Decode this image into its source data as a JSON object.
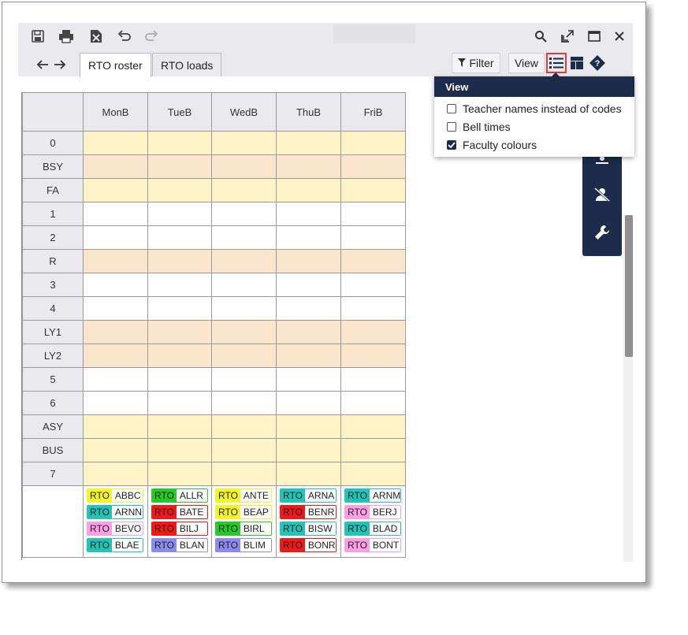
{
  "toolbar": {
    "tabs": [
      {
        "label": "RTO roster",
        "active": true
      },
      {
        "label": "RTO loads",
        "active": false
      }
    ],
    "filter_label": "Filter",
    "view_label": "View"
  },
  "grid": {
    "columns": [
      "MonB",
      "TueB",
      "WedB",
      "ThuB",
      "FriB"
    ],
    "rows": [
      {
        "label": "0",
        "color": "#fff4c8"
      },
      {
        "label": "BSY",
        "color": "#fae6cc"
      },
      {
        "label": "FA",
        "color": "#fff4c8"
      },
      {
        "label": "1",
        "color": "#ffffff"
      },
      {
        "label": "2",
        "color": "#ffffff"
      },
      {
        "label": "R",
        "color": "#fae6cc"
      },
      {
        "label": "3",
        "color": "#ffffff"
      },
      {
        "label": "4",
        "color": "#ffffff"
      },
      {
        "label": "LY1",
        "color": "#fae6cc"
      },
      {
        "label": "LY2",
        "color": "#fae6cc"
      },
      {
        "label": "5",
        "color": "#ffffff"
      },
      {
        "label": "6",
        "color": "#ffffff"
      },
      {
        "label": "ASY",
        "color": "#fff4c8"
      },
      {
        "label": "BUS",
        "color": "#fff4c8"
      },
      {
        "label": "7",
        "color": "#fff4c8"
      }
    ],
    "chip_code": "RTO",
    "chips": [
      [
        {
          "name": "ABBC",
          "color": "#f4f42a"
        },
        {
          "name": "ARNN",
          "color": "#22c4b8"
        },
        {
          "name": "BEVO",
          "color": "#ff9ee6"
        },
        {
          "name": "BLAE",
          "color": "#22c4b8"
        }
      ],
      [
        {
          "name": "ALLR",
          "color": "#28c828"
        },
        {
          "name": "BATE",
          "color": "#f01818"
        },
        {
          "name": "BILJ",
          "color": "#f01818"
        },
        {
          "name": "BLAN",
          "color": "#8a8af0"
        }
      ],
      [
        {
          "name": "ANTE",
          "color": "#f4f42a"
        },
        {
          "name": "BEAP",
          "color": "#f4f42a"
        },
        {
          "name": "BIRL",
          "color": "#28c828"
        },
        {
          "name": "BLIM",
          "color": "#8a8af0"
        }
      ],
      [
        {
          "name": "ARNA",
          "color": "#22c4b8"
        },
        {
          "name": "BENR",
          "color": "#f01818"
        },
        {
          "name": "BISW",
          "color": "#22c4b8"
        },
        {
          "name": "BONR",
          "color": "#f01818"
        }
      ],
      [
        {
          "name": "ARNM",
          "color": "#22c4b8"
        },
        {
          "name": "BERJ",
          "color": "#ff9ee6"
        },
        {
          "name": "BLAD",
          "color": "#22c4b8"
        },
        {
          "name": "BONT",
          "color": "#ff9ee6"
        }
      ]
    ]
  },
  "view_menu": {
    "title": "View",
    "options": [
      {
        "label": "Teacher names instead of codes",
        "checked": false
      },
      {
        "label": "Bell times",
        "checked": false
      },
      {
        "label": "Faculty colours",
        "checked": true
      }
    ]
  },
  "colors": {
    "accent_dark": "#1c2c4a",
    "highlight_border": "#e33b3b"
  }
}
